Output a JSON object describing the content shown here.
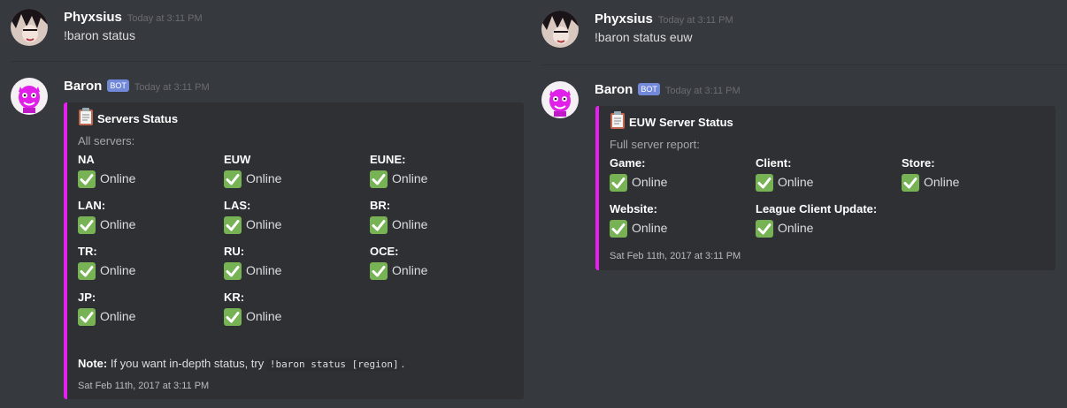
{
  "left": {
    "user_msg": {
      "username": "Phyxsius",
      "timestamp": "Today at 3:11 PM",
      "text": "!baron status"
    },
    "bot_msg": {
      "username": "Baron",
      "bot_tag": "BOT",
      "timestamp": "Today at 3:11 PM",
      "embed": {
        "accent_color": "#e91ef0",
        "title_icon": "clipboard-icon",
        "title": "Servers Status",
        "description": "All servers:",
        "fields": [
          {
            "name": "NA",
            "value": "Online"
          },
          {
            "name": "EUW",
            "value": "Online"
          },
          {
            "name": "EUNE:",
            "value": "Online"
          },
          {
            "name": "LAN:",
            "value": "Online"
          },
          {
            "name": "LAS:",
            "value": "Online"
          },
          {
            "name": "BR:",
            "value": "Online"
          },
          {
            "name": "TR:",
            "value": "Online"
          },
          {
            "name": "RU:",
            "value": "Online"
          },
          {
            "name": "OCE:",
            "value": "Online"
          },
          {
            "name": "JP:",
            "value": "Online"
          },
          {
            "name": "KR:",
            "value": "Online"
          }
        ],
        "note_label": "Note:",
        "note_text": " If you want in-depth status, try ",
        "note_code": "!baron status [region]",
        "note_end": ".",
        "footer": "Sat Feb 11th, 2017 at 3:11 PM"
      }
    }
  },
  "right": {
    "user_msg": {
      "username": "Phyxsius",
      "timestamp": "Today at 3:11 PM",
      "text": "!baron status euw"
    },
    "bot_msg": {
      "username": "Baron",
      "bot_tag": "BOT",
      "timestamp": "Today at 3:11 PM",
      "embed": {
        "accent_color": "#e91ef0",
        "title_icon": "clipboard-icon",
        "title": "EUW Server Status",
        "description": "Full server report:",
        "fields": [
          {
            "name": "Game:",
            "value": "Online"
          },
          {
            "name": "Client:",
            "value": "Online"
          },
          {
            "name": "Store:",
            "value": "Online"
          },
          {
            "name": "Website:",
            "value": "Online"
          },
          {
            "name": "League Client Update:",
            "value": "Online"
          }
        ],
        "footer": "Sat Feb 11th, 2017 at 3:11 PM"
      }
    }
  },
  "status_icon": "white-check-mark-icon",
  "status_color": "#77b255"
}
